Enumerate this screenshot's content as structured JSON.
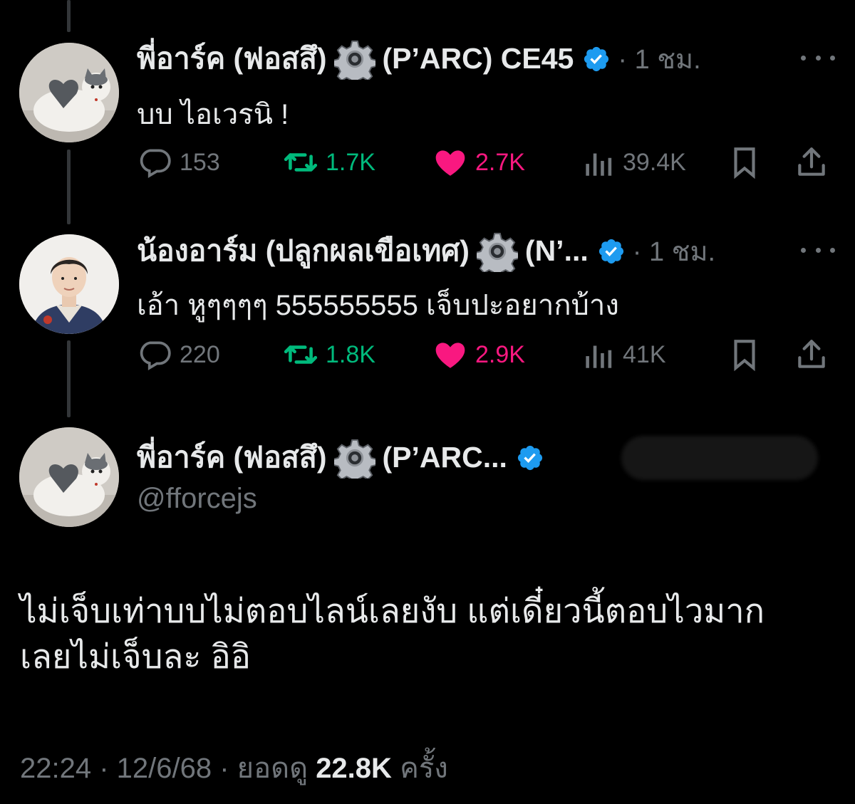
{
  "colors": {
    "background": "#000000",
    "text": "#e7e9ea",
    "muted": "#71767b",
    "verified": "#1d9bf0",
    "retweet": "#00ba7c",
    "like": "#f91880"
  },
  "tweets": [
    {
      "name": "พี่อาร์ค (ฟอสสึ)",
      "name_suffix": "(P’ARC) CE45",
      "time": "· 1 ชม.",
      "text": "บบ ไอเวรนิ !",
      "replies": "153",
      "retweets": "1.7K",
      "likes": "2.7K",
      "views": "39.4K",
      "avatar_icon": "cat-avatar-icon"
    },
    {
      "name": "น้องอาร์ม (ปลูกผลเขือเทศ)",
      "name_suffix": "(N’...",
      "time": "· 1 ชม.",
      "text": "เอ้า หูๆๆๆๆ 555555555 เจ็บปะอยากบ้าง",
      "replies": "220",
      "retweets": "1.8K",
      "likes": "2.9K",
      "views": "41K",
      "avatar_icon": "person-avatar-icon"
    }
  ],
  "main_tweet": {
    "name": "พี่อาร์ค (ฟอสสึ)",
    "name_suffix": "(P’ARC...",
    "handle": "@fforcejs",
    "text_line1": "ไม่เจ็บเท่าบบไม่ตอบไลน์เลยงับ แต่เดี๋ยวนี้ตอบไวมาก",
    "text_line2": "เลยไม่เจ็บละ อิอิ",
    "timestamp": "22:24 · 12/6/68 · ยอดดู",
    "views": "22.8K",
    "views_suffix": "ครั้ง"
  }
}
